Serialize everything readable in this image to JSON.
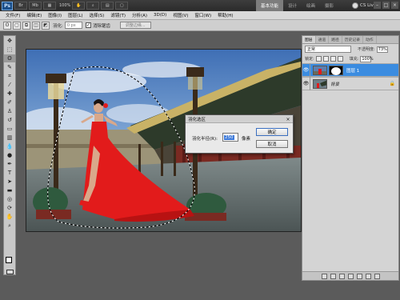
{
  "titlebar": {
    "zoom": "100%",
    "workspaces": [
      "基本功能",
      "设计",
      "绘画",
      "摄影"
    ],
    "active_workspace": "基本功能",
    "cs_live": "CS Live"
  },
  "menu": [
    "文件(F)",
    "编辑(E)",
    "图像(I)",
    "图层(L)",
    "选择(S)",
    "滤镜(T)",
    "分析(A)",
    "3D(D)",
    "视图(V)",
    "窗口(W)",
    "帮助(H)"
  ],
  "options": {
    "feather_label": "羽化:",
    "feather_value": "0 px",
    "antialias_label": "消除锯齿",
    "refine_button": "调整边缘..."
  },
  "layers_panel": {
    "tabs": [
      "图层",
      "通道",
      "路径",
      "历史记录",
      "动作"
    ],
    "blend_mode": "正常",
    "opacity_label": "不透明度:",
    "opacity": "73%",
    "lock_label": "锁定:",
    "fill_label": "填充:",
    "fill": "100%",
    "layers": [
      {
        "name": "图层 1",
        "selected": true,
        "has_mask": true
      },
      {
        "name": "背景",
        "selected": false,
        "has_mask": false
      }
    ]
  },
  "dialog": {
    "title": "羽化选区",
    "label": "羽化半径(R):",
    "value": "250",
    "unit": "像素",
    "ok": "确定",
    "cancel": "取消"
  },
  "colors": {
    "selection_highlight": "#3b8ce0",
    "dress_red": "#e21b1b"
  }
}
